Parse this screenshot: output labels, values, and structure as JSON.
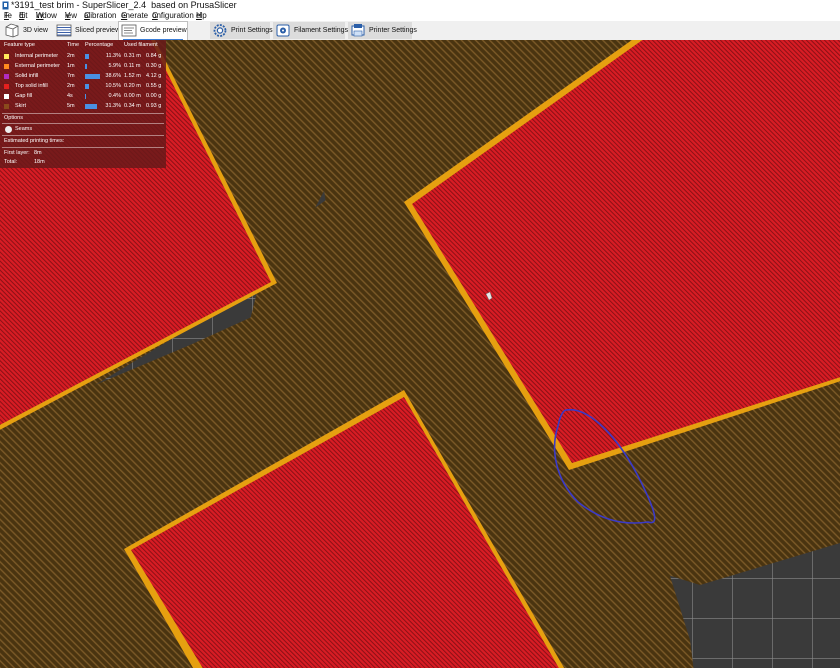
{
  "window": {
    "title": "*3191_test brim - SuperSlicer_2.4  based on PrusaSlicer"
  },
  "menu": [
    {
      "label": "File",
      "ul": "F",
      "rest": "ile"
    },
    {
      "label": "Edit",
      "ul": "E",
      "rest": "dit"
    },
    {
      "label": "Window",
      "ul": "W",
      "rest": "indow"
    },
    {
      "label": "View",
      "ul": "V",
      "rest": "iew"
    },
    {
      "label": "Calibration",
      "ul": "C",
      "rest": "alibration"
    },
    {
      "label": "Generate",
      "ul": "G",
      "rest": "enerate"
    },
    {
      "label": "Configuration",
      "ul": "C",
      "rest": "onfiguration"
    },
    {
      "label": "Help",
      "ul": "H",
      "rest": "elp"
    }
  ],
  "tabs": {
    "view3d": "3D view",
    "sliced": "Sliced preview",
    "gcode": "Gcode preview",
    "print": "Print Settings",
    "filament": "Filament Settings",
    "printer": "Printer Settings",
    "active": "Gcode preview"
  },
  "legend": {
    "headers": {
      "feature": "Feature type",
      "time": "Time",
      "percentage": "Percentage",
      "used": "Used filament"
    },
    "rows": [
      {
        "name": "Internal perimeter",
        "color": "#ffe65a",
        "time": "2m",
        "pct_value": 11.3,
        "pct": "11.3%",
        "length": "0.31 m",
        "weight": "0.84 g"
      },
      {
        "name": "External perimeter",
        "color": "#ff8a1e",
        "time": "1m",
        "pct_value": 5.9,
        "pct": "5.9%",
        "length": "0.11 m",
        "weight": "0.30 g"
      },
      {
        "name": "Solid infill",
        "color": "#b02cc0",
        "time": "7m",
        "pct_value": 38.6,
        "pct": "38.6%",
        "length": "1.52 m",
        "weight": "4.12 g"
      },
      {
        "name": "Top solid infill",
        "color": "#e6201e",
        "time": "2m",
        "pct_value": 10.5,
        "pct": "10.5%",
        "length": "0.20 m",
        "weight": "0.55 g"
      },
      {
        "name": "Gap fill",
        "color": "#ffffff",
        "time": "4s",
        "pct_value": 0.4,
        "pct": "0.4%",
        "length": "0.00 m",
        "weight": "0.00 g"
      },
      {
        "name": "Skirt",
        "color": "#8a4a1c",
        "time": "5m",
        "pct_value": 31.3,
        "pct": "31.3%",
        "length": "0.34 m",
        "weight": "0.93 g"
      }
    ],
    "options_label": "Options",
    "seams_label": "Seams",
    "est_label": "Estimated printing times:",
    "first_layer_label": "First layer:",
    "first_layer_value": "8m",
    "total_label": "Total:",
    "total_value": "18m"
  },
  "colors": {
    "background": "#3a3a3a",
    "bed_grid": "#8a8a8a",
    "brim": "#4a3410",
    "brim_line": "#7c5a28",
    "top_infill": "#d81c24",
    "perimeter": "#e6a010",
    "annotation": "#3a3ac8"
  }
}
